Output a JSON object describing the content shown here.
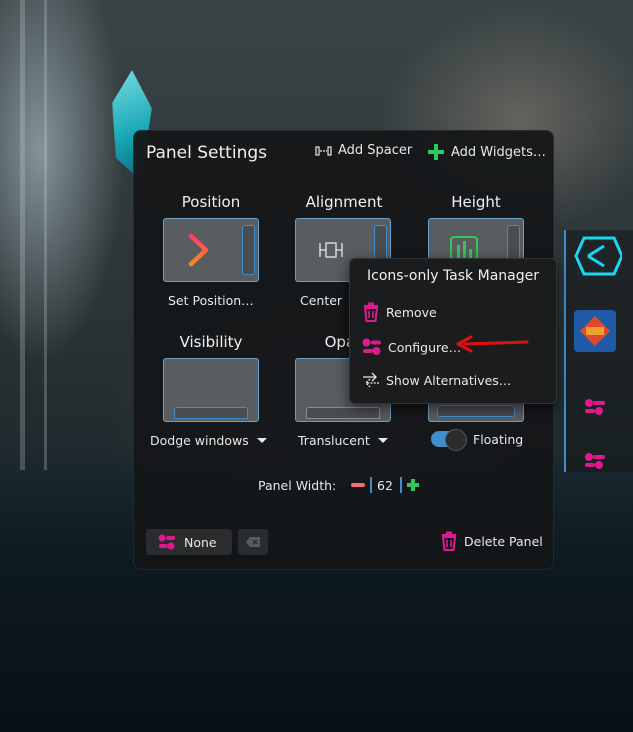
{
  "dialog": {
    "title": "Panel Settings",
    "add_spacer": "Add Spacer",
    "add_widgets": "Add Widgets…",
    "position": {
      "label": "Position",
      "value": "Set Position…"
    },
    "alignment": {
      "label": "Alignment",
      "value": "Center"
    },
    "height": {
      "label": "Height"
    },
    "visibility": {
      "label": "Visibility",
      "value": "Dodge windows"
    },
    "opacity": {
      "label": "Opac",
      "value": "Translucent"
    },
    "floating": {
      "label": "Floating",
      "on": true
    },
    "panel_width": {
      "label": "Panel Width:",
      "value": "62"
    },
    "shortcut": {
      "value": "None"
    },
    "delete_panel": "Delete Panel"
  },
  "context_menu": {
    "title": "Icons-only Task Manager",
    "items": [
      {
        "label": "Remove",
        "icon": "trash-icon"
      },
      {
        "label": "Configure…",
        "icon": "configure-icon"
      },
      {
        "label": "Show Alternatives…",
        "icon": "alternatives-icon"
      }
    ]
  },
  "colors": {
    "accent": "#3f8fd0",
    "magenta": "#e0198c",
    "green": "#2ec95c",
    "pink": "#f06f7a",
    "annotation_red": "#e01010"
  }
}
